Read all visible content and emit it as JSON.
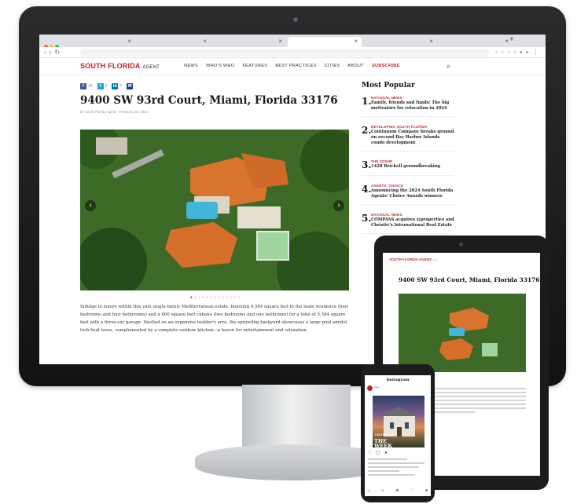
{
  "site": {
    "logo_main": "SOUTH FLORIDA",
    "logo_sub": "AGENT",
    "nav": [
      "NEWS",
      "WHO'S WHO",
      "FEATURES",
      "BEST PRACTICES",
      "CITIES",
      "ABOUT"
    ],
    "subscribe": "SUBSCRIBE"
  },
  "article": {
    "title": "9400 SW 93rd Court, Miami, Florida 33176",
    "byline": "by South Florida Agent  ·  February 20, 2024",
    "share_counts": [
      "15",
      "2",
      "7"
    ],
    "body": "Indulge in luxury within this vast single-family Mediterranean estate, boasting 4,584 square feet in the main residence (four bedrooms and four bathrooms) and a 600 square foot cabana (two bedrooms and one bathroom) for a total of 5,584 square feet with a three-car garage. Nestled on an expansive builder's acre, the sprawling backyard showcases a large pool amidst lush fruit trees, complemented by a complete outdoor kitchen—a haven for entertainment and relaxation."
  },
  "popular": {
    "title": "Most Popular",
    "items": [
      {
        "num": "1.",
        "category": "NATIONAL NEWS",
        "title": "Family, friends and funds: The big motivators for relocation in 2024"
      },
      {
        "num": "2.",
        "category": "DEVELOPING SOUTH FLORIDA",
        "title": "Continuum Company breaks ground on second Bay Harbor Islands condo development"
      },
      {
        "num": "3.",
        "category": "THE SCENE",
        "title": "1428 Brickell groundbreaking"
      },
      {
        "num": "4.",
        "category": "AGENTS' CHOICE",
        "title": "Announcing the 2024 South Florida Agents' Choice Awards winners"
      },
      {
        "num": "5.",
        "category": "NATIONAL NEWS",
        "title": "COMPASS acquires @properties and Christie's International Real Estate"
      }
    ]
  },
  "phone": {
    "app_title": "Instagram",
    "overlay_small": "LISTING OF",
    "overlay_big": "THE\nWEEK"
  },
  "colors": {
    "brand_red": "#c41f28",
    "facebook": "#3b5998",
    "twitter": "#1da1f2",
    "linkedin": "#0077b5",
    "email": "#1a3d8f"
  }
}
